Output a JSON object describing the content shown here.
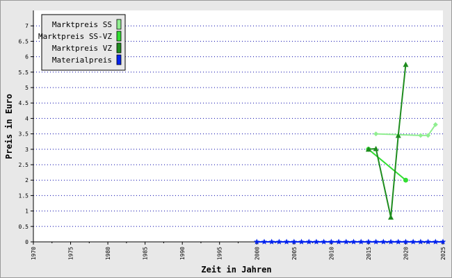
{
  "chart_data": {
    "type": "line",
    "xlabel": "Zeit in Jahren",
    "ylabel": "Preis in Euro",
    "xlim": [
      1970,
      2025
    ],
    "ylim": [
      0,
      7.5
    ],
    "x_ticks": [
      "1970",
      "1975",
      "1980",
      "1985",
      "1990",
      "1995",
      "2000",
      "2005",
      "2010",
      "2015",
      "2020",
      "2025"
    ],
    "y_ticks": [
      "0",
      "0.5",
      "1",
      "1.5",
      "2",
      "2.5",
      "3",
      "3.5",
      "4",
      "4.5",
      "5",
      "5.5",
      "6",
      "6.5",
      "7"
    ],
    "grid": "horizontal dotted",
    "legend_position": "top-left",
    "series": [
      {
        "name": "Marktpreis SS",
        "color": "#90ee90",
        "marker": "diamond",
        "points": [
          [
            2016,
            3.5
          ],
          [
            2022,
            3.45
          ],
          [
            2023,
            3.45
          ],
          [
            2024,
            3.8
          ]
        ]
      },
      {
        "name": "Marktpreis SS-VZ",
        "color": "#33dd33",
        "marker": "circle",
        "points": [
          [
            2015,
            3.0
          ],
          [
            2020,
            2.0
          ]
        ]
      },
      {
        "name": "Marktpreis VZ",
        "color": "#1e8c1e",
        "marker": "triangle",
        "points": [
          [
            2015,
            3.0
          ],
          [
            2016,
            3.02
          ],
          [
            2018,
            0.8
          ],
          [
            2019,
            3.45
          ],
          [
            2020,
            5.75
          ]
        ]
      },
      {
        "name": "Materialpreis",
        "color": "#0022ee",
        "marker": "star",
        "points": [
          [
            2000,
            0
          ],
          [
            2001,
            0
          ],
          [
            2002,
            0
          ],
          [
            2003,
            0
          ],
          [
            2004,
            0
          ],
          [
            2005,
            0
          ],
          [
            2006,
            0
          ],
          [
            2007,
            0
          ],
          [
            2008,
            0
          ],
          [
            2009,
            0
          ],
          [
            2010,
            0
          ],
          [
            2011,
            0
          ],
          [
            2012,
            0
          ],
          [
            2013,
            0
          ],
          [
            2014,
            0
          ],
          [
            2015,
            0
          ],
          [
            2016,
            0
          ],
          [
            2017,
            0
          ],
          [
            2018,
            0
          ],
          [
            2019,
            0
          ],
          [
            2020,
            0
          ],
          [
            2021,
            0
          ],
          [
            2022,
            0
          ],
          [
            2023,
            0
          ],
          [
            2024,
            0
          ],
          [
            2025,
            0
          ]
        ]
      }
    ]
  }
}
